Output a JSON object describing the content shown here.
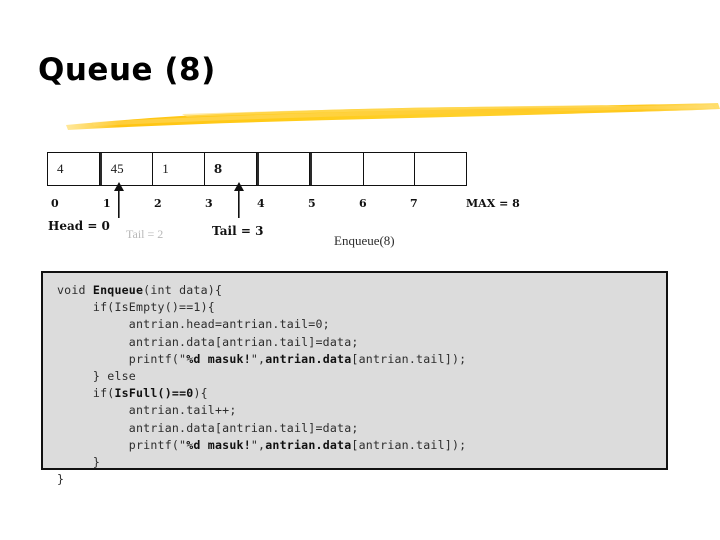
{
  "slide": {
    "title": "Queue (8)",
    "underline_color_left": "#FFC107",
    "underline_color_right": "#FFD23A"
  },
  "queue": {
    "cells": [
      {
        "value": "4",
        "index": "0",
        "filled": true,
        "highlight": false
      },
      {
        "value": "45",
        "index": "1",
        "filled": true,
        "highlight": false
      },
      {
        "value": "1",
        "index": "2",
        "filled": true,
        "highlight": false
      },
      {
        "value": "8",
        "index": "3",
        "filled": true,
        "highlight": true
      },
      {
        "value": "",
        "index": "4",
        "filled": false,
        "highlight": false
      },
      {
        "value": "",
        "index": "5",
        "filled": false,
        "highlight": false
      },
      {
        "value": "",
        "index": "6",
        "filled": false,
        "highlight": false
      },
      {
        "value": "",
        "index": "7",
        "filled": false,
        "highlight": false
      }
    ],
    "indices": [
      "0",
      "1",
      "2",
      "3",
      "4",
      "5",
      "6",
      "7"
    ],
    "max_label": "MAX = 8",
    "head_caption": "Head = 0",
    "tail_old_caption": "Tail = 2",
    "tail_new_caption": "Tail = 3",
    "operation_caption": "Enqueue(8)",
    "head_arrow_icon": "up-arrow-icon",
    "tail_arrow_icon": "up-arrow-icon"
  },
  "code": {
    "language": "c",
    "lines": [
      "void <b>Enqueue</b>(int data){",
      "     if(IsEmpty()==1){",
      "          antrian.head=antrian.tail=0;",
      "          antrian.data[antrian.tail]=data;",
      "          printf(\"<b>%d masuk!</b>\",<b>antrian.data</b>[antrian.tail]);",
      "     } else",
      "     if(<b>IsFull()==0</b>){",
      "          antrian.tail++;",
      "          antrian.data[antrian.tail]=data;",
      "          printf(\"<b>%d masuk!</b>\",<b>antrian.data</b>[antrian.tail]);",
      "     }",
      "}"
    ]
  }
}
